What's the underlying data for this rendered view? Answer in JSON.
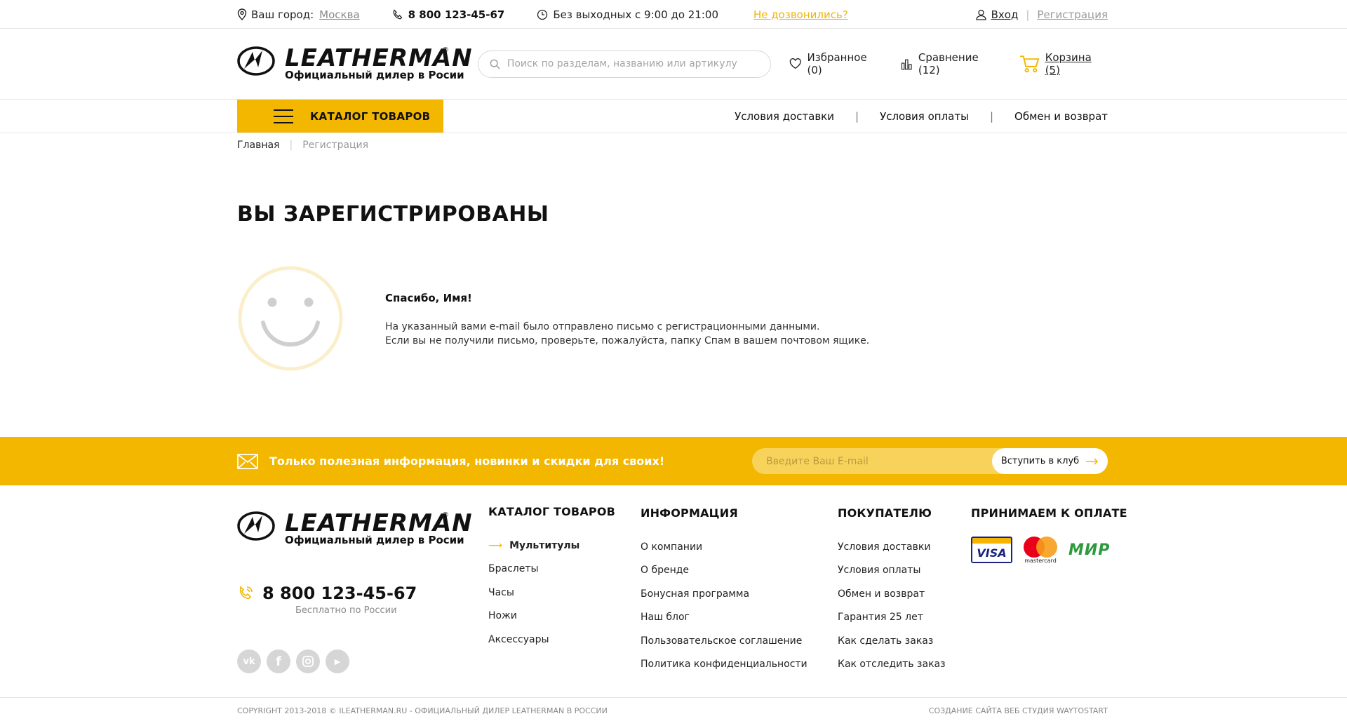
{
  "topbar": {
    "city_label": "Ваш город:",
    "city": "Москва",
    "phone": "8 800 123-45-67",
    "hours": "Без выходных с 9:00 до 21:00",
    "callback": "Не дозвонились?",
    "login": "Вход",
    "separator": "|",
    "register": "Регистрация"
  },
  "header": {
    "logo_word": "LEATHERMAN",
    "logo_reg": "®",
    "logo_sub": "Официальный дилер в Росии",
    "search_placeholder": "Поиск по разделам, названию или артикулу",
    "favorites": "Избранное (0)",
    "compare": "Сравнение (12)",
    "cart": "Корзина (5)"
  },
  "nav": {
    "catalog": "КАТАЛОГ ТОВАРОВ",
    "links": [
      "Условия доставки",
      "Условия оплаты",
      "Обмен и возврат"
    ],
    "separator": "|"
  },
  "breadcrumb": {
    "home": "Главная",
    "separator": "|",
    "current": "Регистрация"
  },
  "main": {
    "title": "ВЫ ЗАРЕГИСТРИРОВАНЫ",
    "thanks": "Спасибо, Имя!",
    "line1": "На указанный вами e-mail было отправлено письмо с регистрационными данными.",
    "line2": "Если вы не получили письмо, проверьте, пожалуйста, папку Спам в вашем почтовом ящике."
  },
  "subscribe": {
    "text": "Только полезная информация, новинки и скидки для своих!",
    "placeholder": "Введите Ваш E-mail",
    "button": "Вступить в клуб"
  },
  "footer": {
    "phone": "8 800 123-45-67",
    "phone_sub": "Бесплатно по России",
    "socials": [
      "vk",
      "facebook",
      "instagram",
      "youtube"
    ],
    "catalog": {
      "title": "КАТАЛОГ ТОВАРОВ",
      "items": [
        "Мультитулы",
        "Браслеты",
        "Часы",
        "Ножи",
        "Аксессуары"
      ]
    },
    "info": {
      "title": "ИНФОРМАЦИЯ",
      "items": [
        "О компании",
        "О бренде",
        "Бонусная программа",
        "Наш блог",
        "Пользовательское соглашение",
        "Политика конфиденциальности"
      ]
    },
    "buyer": {
      "title": "ПОКУПАТЕЛЮ",
      "items": [
        "Условия доставки",
        "Условия оплаты",
        "Обмен и возврат",
        "Гарантия 25 лет",
        "Как сделать заказ",
        "Как отследить заказ"
      ]
    },
    "pay": {
      "title": "ПРИНИМАЕМ К ОПЛАТЕ",
      "visa": "VISA",
      "mastercard": "mastercard",
      "mir": "МИР"
    },
    "copyright": "COPYRIGHT 2013-2018 © ILEATHERMAN.RU - ОФИЦИАЛЬНЫЙ ДИЛЕР LEATHERMAN В РОССИИ",
    "credits": "СОЗДАНИЕ САЙТА ВЕБ СТУДИЯ WAYTOSTART"
  },
  "colors": {
    "accent": "#f3b700",
    "link_accent": "#f0b400",
    "text": "#111111"
  }
}
